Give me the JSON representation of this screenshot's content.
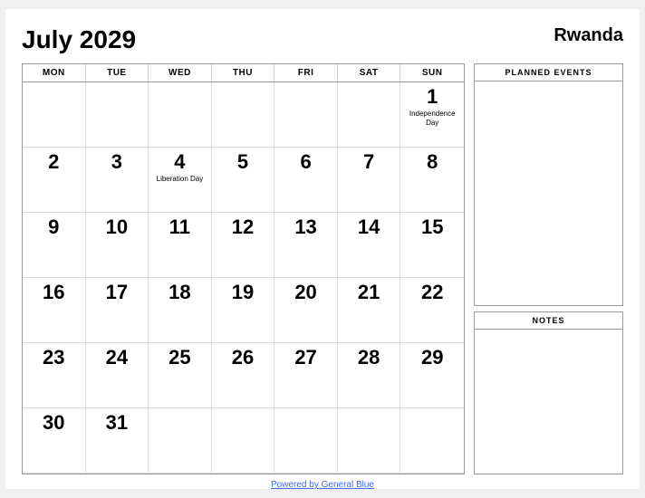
{
  "header": {
    "title": "July 2029",
    "country": "Rwanda"
  },
  "day_headers": [
    "MON",
    "TUE",
    "WED",
    "THU",
    "FRI",
    "SAT",
    "SUN"
  ],
  "weeks": [
    [
      {
        "day": "",
        "empty": true
      },
      {
        "day": "",
        "empty": true
      },
      {
        "day": "",
        "empty": true
      },
      {
        "day": "",
        "empty": true
      },
      {
        "day": "",
        "empty": true
      },
      {
        "day": "",
        "empty": true
      },
      {
        "day": "1",
        "holiday": "Independence\nDay"
      }
    ],
    [
      {
        "day": "2"
      },
      {
        "day": "3"
      },
      {
        "day": "4",
        "holiday": "Liberation Day"
      },
      {
        "day": "5"
      },
      {
        "day": "6"
      },
      {
        "day": "7"
      },
      {
        "day": "8"
      }
    ],
    [
      {
        "day": "9"
      },
      {
        "day": "10"
      },
      {
        "day": "11"
      },
      {
        "day": "12"
      },
      {
        "day": "13"
      },
      {
        "day": "14"
      },
      {
        "day": "15"
      }
    ],
    [
      {
        "day": "16"
      },
      {
        "day": "17"
      },
      {
        "day": "18"
      },
      {
        "day": "19"
      },
      {
        "day": "20"
      },
      {
        "day": "21"
      },
      {
        "day": "22"
      }
    ],
    [
      {
        "day": "23"
      },
      {
        "day": "24"
      },
      {
        "day": "25"
      },
      {
        "day": "26"
      },
      {
        "day": "27"
      },
      {
        "day": "28"
      },
      {
        "day": "29"
      }
    ],
    [
      {
        "day": "30"
      },
      {
        "day": "31"
      },
      {
        "day": "",
        "empty": true
      },
      {
        "day": "",
        "empty": true
      },
      {
        "day": "",
        "empty": true
      },
      {
        "day": "",
        "empty": true
      },
      {
        "day": "",
        "empty": true
      }
    ]
  ],
  "right_panel": {
    "planned_events_label": "PLANNED EVENTS",
    "notes_label": "NOTES"
  },
  "footer": {
    "link_text": "Powered by General Blue",
    "link_url": "#"
  }
}
